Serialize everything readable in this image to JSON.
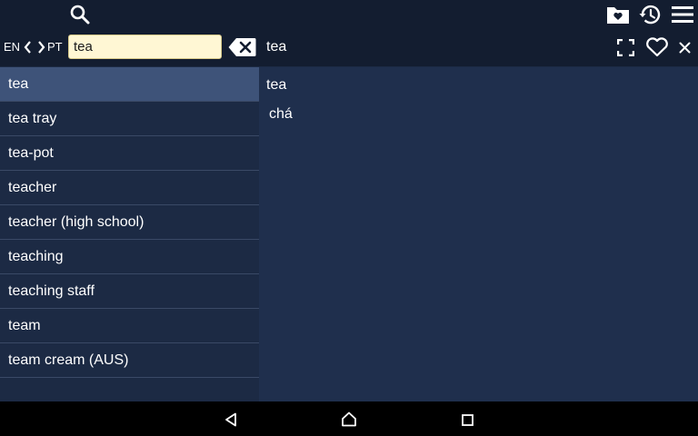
{
  "toolbar": {
    "icons": [
      "search-icon",
      "favorites-folder-icon",
      "history-icon",
      "menu-icon"
    ]
  },
  "language_bar": {
    "source_lang": "EN",
    "target_lang": "PT",
    "search_value": "tea",
    "header_word": "tea"
  },
  "word_list": {
    "items": [
      "tea",
      "tea tray",
      "tea-pot",
      "teacher",
      "teacher (high school)",
      "teaching",
      "teaching staff",
      "team",
      "team cream (AUS)"
    ],
    "selected_index": 0
  },
  "detail": {
    "word": "tea",
    "translation": "chá"
  },
  "colors": {
    "bar_bg": "#131d30",
    "panel_bg": "#1c2a44",
    "selected_bg": "#3e5379",
    "search_bg": "#fff7d4"
  }
}
